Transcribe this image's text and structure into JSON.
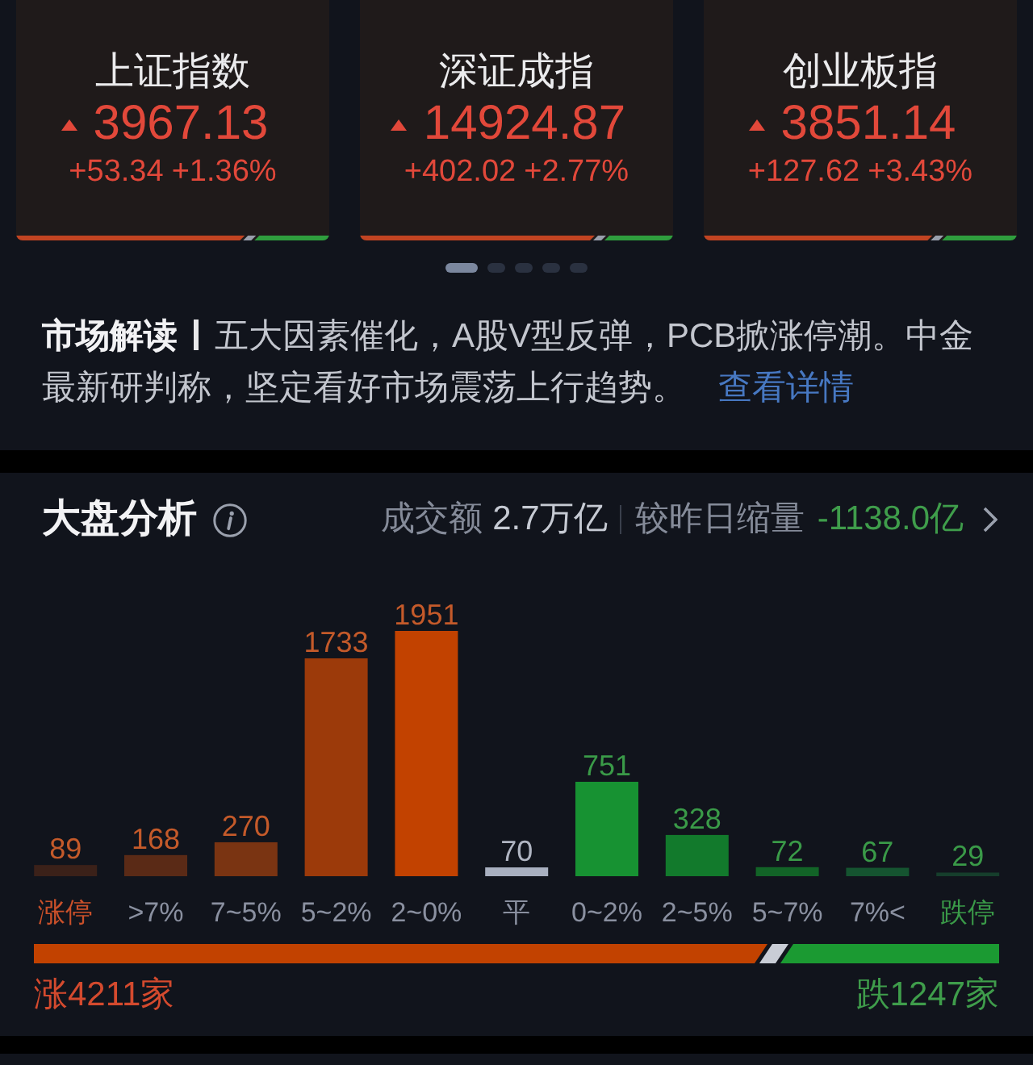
{
  "indices": [
    {
      "name": "上证指数",
      "rising": true,
      "value": "3967.13",
      "change": "+53.34",
      "change_pct": "+1.36%",
      "breadth": {
        "level": 0.73
      }
    },
    {
      "name": "深证成指",
      "rising": true,
      "value": "14924.87",
      "change": "+402.02",
      "change_pct": "+2.77%",
      "breadth": {
        "level": 0.75
      }
    },
    {
      "name": "创业板指",
      "rising": true,
      "value": "3851.14",
      "change": "+127.62",
      "change_pct": "+3.43%",
      "breadth": {
        "level": 0.73
      }
    }
  ],
  "pager": [
    {
      "selected": true
    },
    {
      "selected": false
    },
    {
      "selected": false
    },
    {
      "selected": false
    },
    {
      "selected": false
    }
  ],
  "commentary": {
    "title": "市场解读",
    "text": "五大因素催化，A股V型反弹，PCB掀涨停潮。中金最新研判称，坚定看好市场震荡上行趋势。",
    "link": "查看详情"
  },
  "market_analysis": {
    "title": "大盘分析",
    "turnover_label": "成交额",
    "turnover": "2.7万亿",
    "compare_label": "较昨日缩量",
    "compare_value": "-1138.0亿",
    "chart_data": {
      "type": "bar",
      "categories": [
        "涨停",
        ">7%",
        "7~5%",
        "5~2%",
        "2~0%",
        "平",
        "0~2%",
        "2~5%",
        "5~7%",
        "7%<",
        "跌停"
      ],
      "values": [
        89,
        168,
        270,
        1733,
        1951,
        70,
        751,
        328,
        72,
        67,
        29
      ],
      "data_labels": true
    },
    "breadth": {
      "level": 0.76
    },
    "rise_count": "涨4211家",
    "fall_count": "跌1247家"
  }
}
